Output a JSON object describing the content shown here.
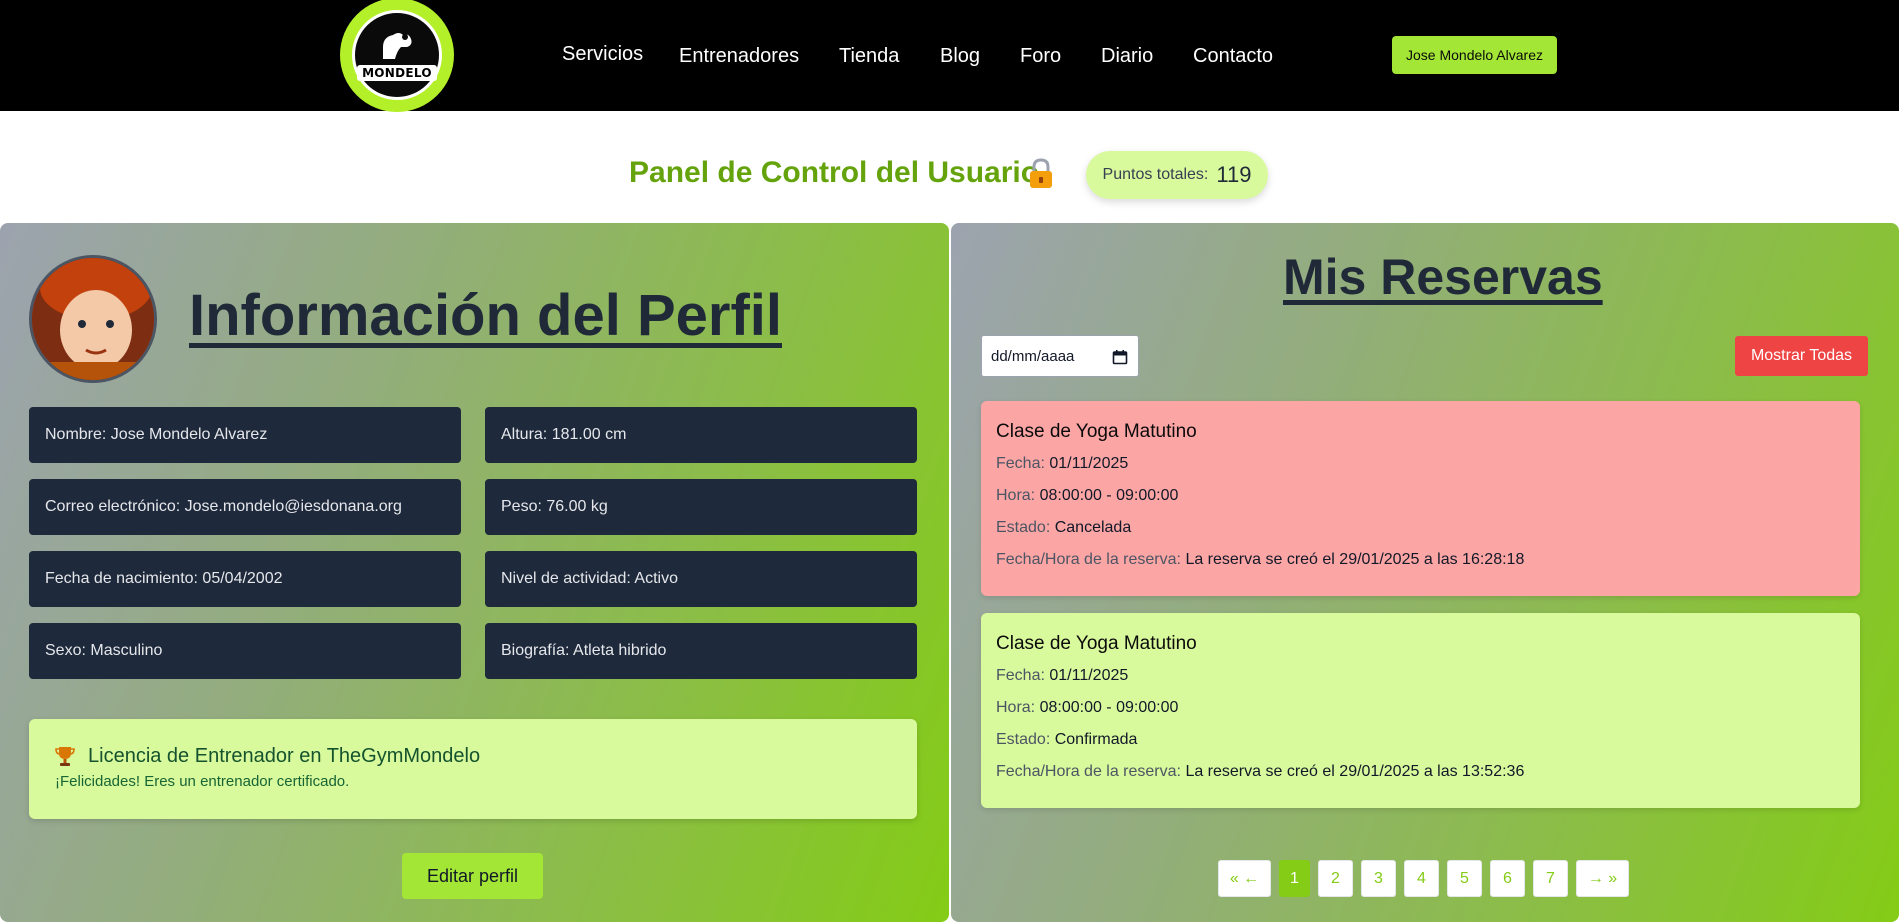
{
  "header": {
    "logo_text": "MONDELO",
    "nav": [
      "Servicios",
      "Entrenadores",
      "Tienda",
      "Blog",
      "Foro",
      "Diario",
      "Contacto"
    ],
    "user_button": "Jose Mondelo Alvarez"
  },
  "dashboard": {
    "title": "Panel de Control del Usuario",
    "points_label": "Puntos totales:",
    "points_value": "119"
  },
  "profile": {
    "heading": "Información del Perfil",
    "fields": [
      "Nombre: Jose Mondelo Alvarez",
      "Altura: 181.00 cm",
      "Correo electrónico: Jose.mondelo@iesdonana.org",
      "Peso: 76.00 kg",
      "Fecha de nacimiento: 05/04/2002",
      "Nivel de actividad: Activo",
      "Sexo: Masculino",
      "Biografía: Atleta hibrido"
    ],
    "license_title": "Licencia de Entrenador en TheGymMondelo",
    "license_text": "¡Felicidades! Eres un entrenador certificado.",
    "edit_button": "Editar perfil"
  },
  "reservations": {
    "heading": "Mis Reservas",
    "date_placeholder": "dd/mm/aaaa",
    "show_all_button": "Mostrar Todas",
    "items": [
      {
        "title": "Clase de Yoga Matutino",
        "fecha_label": "Fecha:",
        "fecha": "01/11/2025",
        "hora_label": "Hora:",
        "hora": "08:00:00 - 09:00:00",
        "estado_label": "Estado:",
        "estado": "Cancelada",
        "reserva_label": "Fecha/Hora de la reserva:",
        "reserva": "La reserva se creó el 29/01/2025 a las 16:28:18",
        "color": "#fca5a5"
      },
      {
        "title": "Clase de Yoga Matutino",
        "fecha_label": "Fecha:",
        "fecha": "01/11/2025",
        "hora_label": "Hora:",
        "hora": "08:00:00 - 09:00:00",
        "estado_label": "Estado:",
        "estado": "Confirmada",
        "reserva_label": "Fecha/Hora de la reserva:",
        "reserva": "La reserva se creó el 29/01/2025 a las 13:52:36",
        "color": "#d9f99d"
      }
    ],
    "pagination": [
      "« ←",
      "1",
      "2",
      "3",
      "4",
      "5",
      "6",
      "7",
      "→ »"
    ],
    "active_page": "1"
  },
  "colors": {
    "accent": "#a3e635",
    "title_green": "#65a30d",
    "danger": "#ef4444"
  }
}
